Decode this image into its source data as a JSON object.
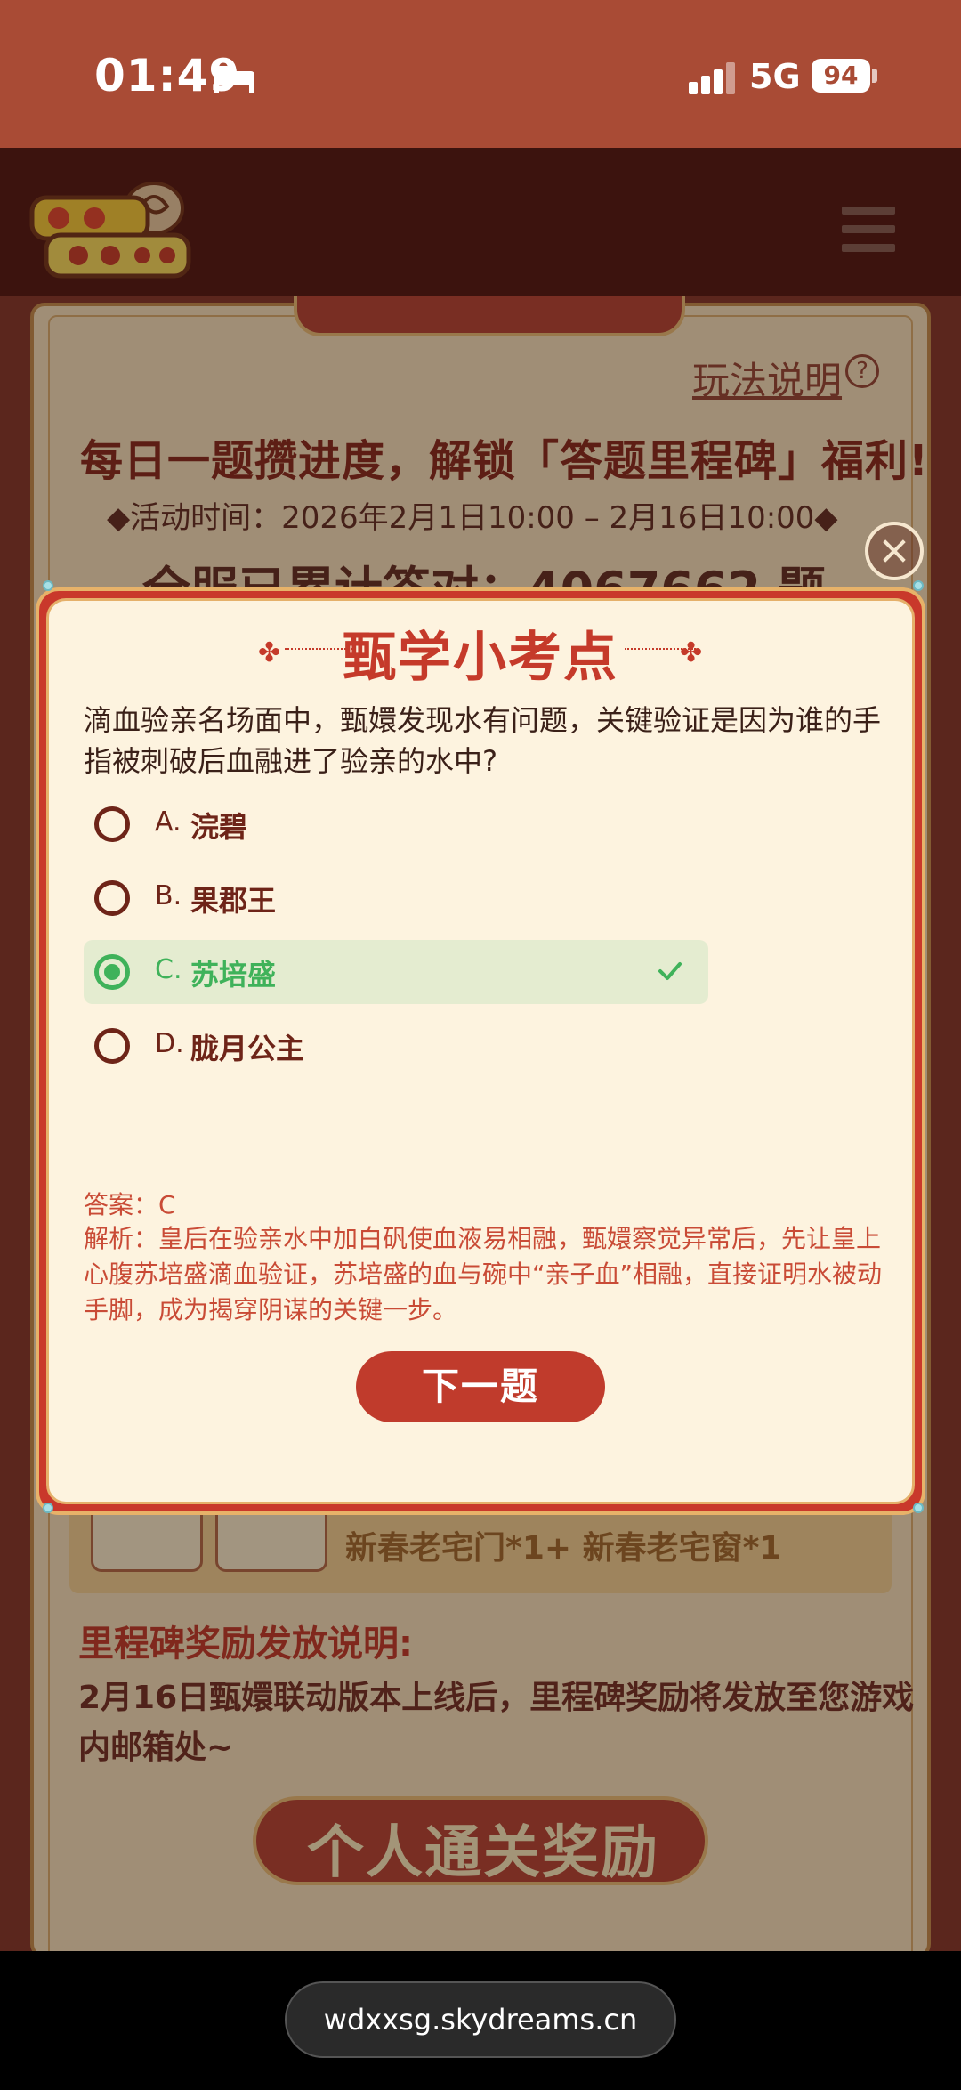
{
  "status_bar": {
    "time": "01:49",
    "network": "5G",
    "battery": "94"
  },
  "background": {
    "rules_label": "玩法说明",
    "rules_q": "?",
    "headline": "每日一题攒进度，解锁「答题里程碑」福利!",
    "activity_time": "◆活动时间：2026年2月1日10:00 – 2月16日10:00◆",
    "answered_count": "全服已累计答对：4067662 题",
    "reward_text": "新春老宅门*1+ 新春老宅窗*1",
    "milestone_title": "里程碑奖励发放说明:",
    "milestone_desc": "2月16日甄嬛联动版本上线后，里程碑奖励将发放至您游戏内邮箱处~",
    "section_banner": "个人通关奖励"
  },
  "quiz": {
    "title": "甄学小考点",
    "question": "滴血验亲名场面中，甄嬛发现水有问题，关键验证是因为谁的手指被刺破后血融进了验亲的水中?",
    "options": [
      {
        "letter": "A.",
        "text": "浣碧"
      },
      {
        "letter": "B.",
        "text": "果郡王"
      },
      {
        "letter": "C.",
        "text": "苏培盛"
      },
      {
        "letter": "D.",
        "text": "胧月公主"
      }
    ],
    "selected_option": "C",
    "answer": "答案：C",
    "explanation": "解析：皇后在验亲水中加白矾使血液易相融，甄嬛察觉异常后，先让皇上心腹苏培盛滴血验证，苏培盛的血与碗中“亲子血”相融，直接证明水被动手脚，成为揭穿阴谋的关键一步。",
    "next_button": "下一题"
  },
  "browser": {
    "url": "wdxxsg.skydreams.cn"
  },
  "colors": {
    "accent_red": "#c53a2a",
    "correct_green": "#3fb25a",
    "modal_bg": "#fdf3df"
  }
}
